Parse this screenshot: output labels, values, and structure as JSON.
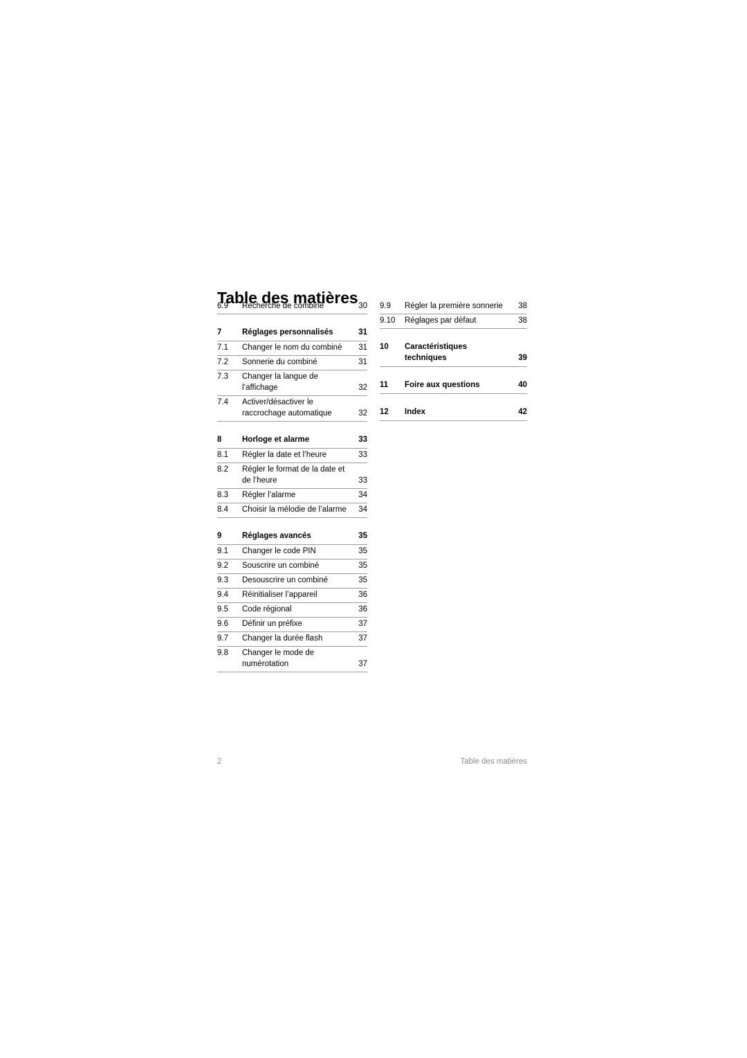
{
  "document": {
    "title": "Table des matières"
  },
  "footer": {
    "page_number": "2",
    "section_label": "Table des matières"
  },
  "toc": {
    "left_column": [
      {
        "number": "6.9",
        "label": "Recherche de combiné",
        "label_line2": "",
        "page": "30",
        "section": false,
        "gap_above": false
      },
      {
        "number": "7",
        "label": "Réglages personnalisés",
        "label_line2": "",
        "page": "31",
        "section": true,
        "gap_above": true
      },
      {
        "number": "7.1",
        "label": "Changer le nom du combiné",
        "label_line2": "",
        "page": "31",
        "section": false,
        "gap_above": false
      },
      {
        "number": "7.2",
        "label": "Sonnerie du combiné",
        "label_line2": "",
        "page": "31",
        "section": false,
        "gap_above": false
      },
      {
        "number": "7.3",
        "label": "Changer la langue de l’affichage",
        "label_line2": "",
        "page": "32",
        "section": false,
        "gap_above": false
      },
      {
        "number": "7.4",
        "label": "Activer/désactiver le",
        "label_line2": "raccrochage automatique",
        "page": "32",
        "section": false,
        "gap_above": false
      },
      {
        "number": "8",
        "label": "Horloge et alarme",
        "label_line2": "",
        "page": "33",
        "section": true,
        "gap_above": true
      },
      {
        "number": "8.1",
        "label": "Régler la date et l’heure",
        "label_line2": "",
        "page": "33",
        "section": false,
        "gap_above": false
      },
      {
        "number": "8.2",
        "label": "Régler le format de la date et",
        "label_line2": "de l’heure",
        "page": "33",
        "section": false,
        "gap_above": false
      },
      {
        "number": "8.3",
        "label": "Régler l’alarme",
        "label_line2": "",
        "page": "34",
        "section": false,
        "gap_above": false
      },
      {
        "number": "8.4",
        "label": "Choisir la mélodie de l’alarme",
        "label_line2": "",
        "page": "34",
        "section": false,
        "gap_above": false
      },
      {
        "number": "9",
        "label": "Réglages avancés",
        "label_line2": "",
        "page": "35",
        "section": true,
        "gap_above": true
      },
      {
        "number": "9.1",
        "label": "Changer le code PIN",
        "label_line2": "",
        "page": "35",
        "section": false,
        "gap_above": false
      },
      {
        "number": "9.2",
        "label": "Souscrire un combiné",
        "label_line2": "",
        "page": "35",
        "section": false,
        "gap_above": false
      },
      {
        "number": "9.3",
        "label": "Desouscrire un combiné",
        "label_line2": "",
        "page": "35",
        "section": false,
        "gap_above": false
      },
      {
        "number": "9.4",
        "label": "Réinitialiser l’appareil",
        "label_line2": "",
        "page": "36",
        "section": false,
        "gap_above": false
      },
      {
        "number": "9.5",
        "label": "Code régional",
        "label_line2": "",
        "page": "36",
        "section": false,
        "gap_above": false
      },
      {
        "number": "9.6",
        "label": "Définir un préfixe",
        "label_line2": "",
        "page": "37",
        "section": false,
        "gap_above": false
      },
      {
        "number": "9.7",
        "label": "Changer la durée flash",
        "label_line2": "",
        "page": "37",
        "section": false,
        "gap_above": false
      },
      {
        "number": "9.8",
        "label": "Changer le mode de",
        "label_line2": "numérotation",
        "page": "37",
        "section": false,
        "gap_above": false
      }
    ],
    "right_column": [
      {
        "number": "9.9",
        "label": "Régler la première sonnerie",
        "label_line2": "",
        "page": "38",
        "section": false,
        "gap_above": false
      },
      {
        "number": "9.10",
        "label": "Réglages par défaut",
        "label_line2": "",
        "page": "38",
        "section": false,
        "gap_above": false
      },
      {
        "number": "10",
        "label": "Caractéristiques",
        "label_line2": "techniques",
        "page": "39",
        "section": true,
        "gap_above": true
      },
      {
        "number": "11",
        "label": "Foire aux questions",
        "label_line2": "",
        "page": "40",
        "section": true,
        "gap_above": true
      },
      {
        "number": "12",
        "label": "Index",
        "label_line2": "",
        "page": "42",
        "section": true,
        "gap_above": true
      }
    ]
  },
  "colors": {
    "text": "#000000",
    "rule": "#9a9a9a",
    "footer_text": "#8c8c8c",
    "background": "#ffffff"
  }
}
